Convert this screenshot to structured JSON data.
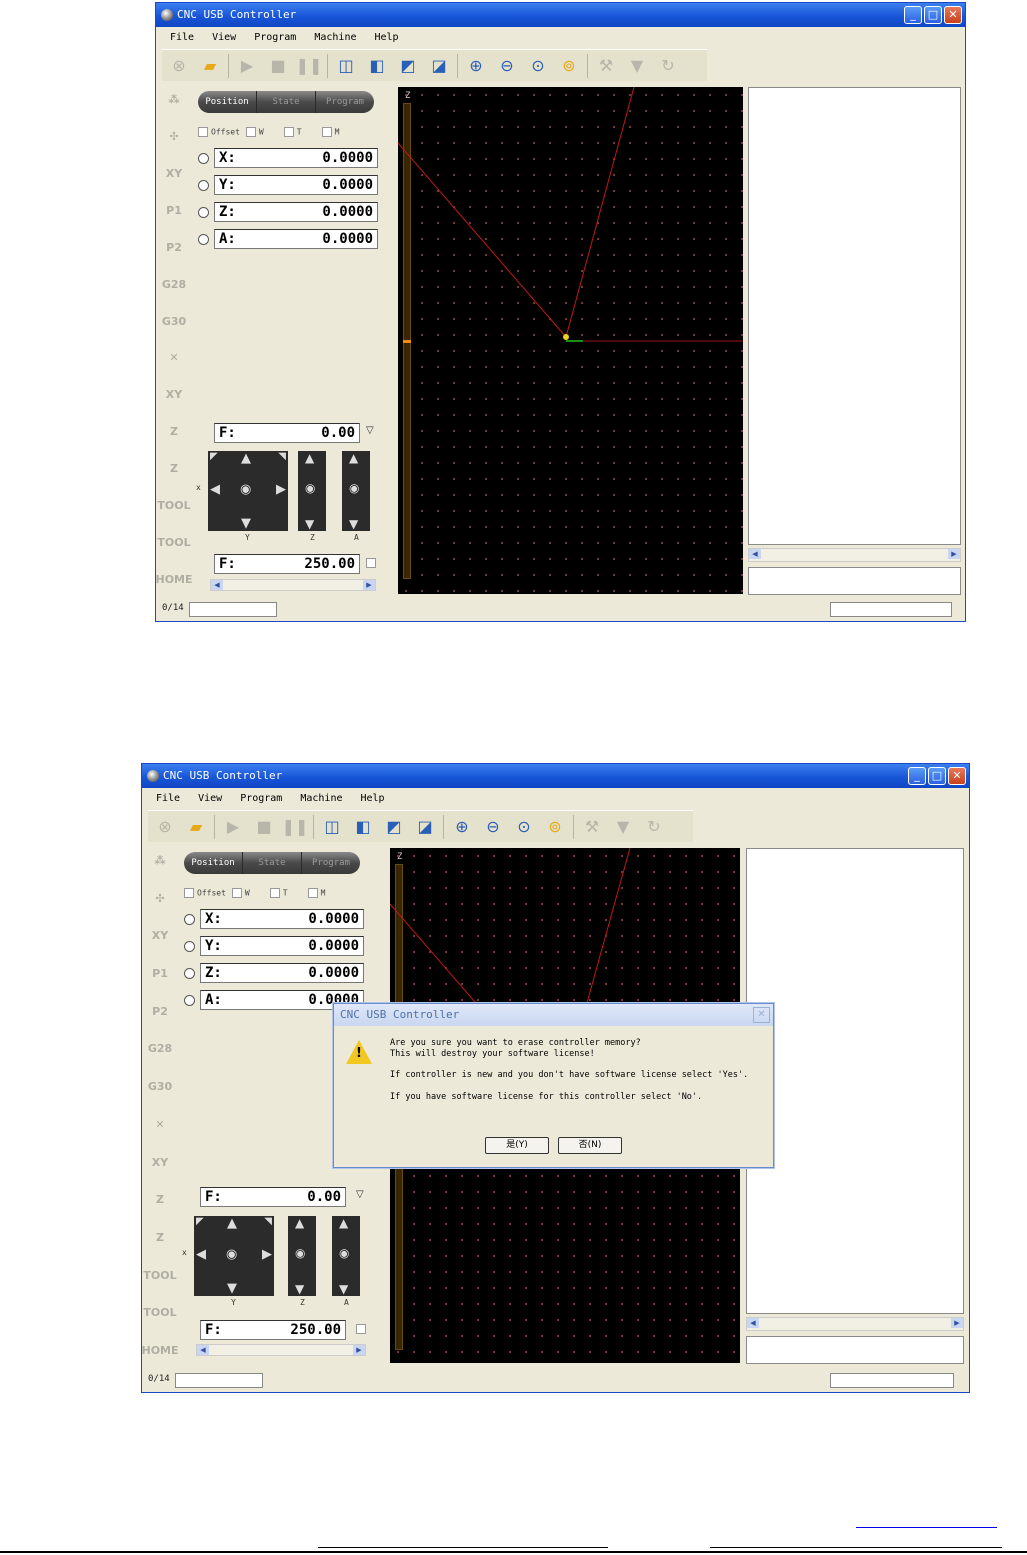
{
  "app": {
    "title": "CNC USB Controller",
    "menu": [
      "File",
      "View",
      "Program",
      "Machine",
      "Help"
    ],
    "title_buttons": [
      "_",
      "□",
      "✕"
    ]
  },
  "toolbar_icons": [
    "stop-icon",
    "open-folder-icon",
    "play-icon",
    "stop-square-icon",
    "pause-icon",
    "cube-front-icon",
    "cube-side-icon",
    "cube-top-icon",
    "cube-iso-icon",
    "zoom-in-icon",
    "zoom-out-icon",
    "zoom-fit-icon",
    "zoom-extents-icon",
    "tool-icon",
    "funnel-icon",
    "refresh-icon"
  ],
  "left_strip": [
    "⁂",
    "✣",
    "XY",
    "P1",
    "P2",
    "G28",
    "G30",
    "✕",
    "XY",
    "Z",
    "Z",
    "TOOL",
    "TOOL",
    "HOME"
  ],
  "tabs": [
    "Position",
    "State",
    "Program"
  ],
  "checkboxes": [
    "Offset",
    "W",
    "T",
    "M"
  ],
  "axes": [
    {
      "label": "X:",
      "value": "0.0000"
    },
    {
      "label": "Y:",
      "value": "0.0000"
    },
    {
      "label": "Z:",
      "value": "0.0000"
    },
    {
      "label": "A:",
      "value": "0.0000"
    }
  ],
  "feed": {
    "label": "F:",
    "value": "0.00"
  },
  "feed_set": {
    "label": "F:",
    "value": "250.00"
  },
  "jog_labels": {
    "x": "x",
    "y": "Y",
    "z": "Z",
    "a": "A"
  },
  "view_axis_label": "Z",
  "status": {
    "counter": "0/14"
  },
  "dialog": {
    "title": "CNC USB Controller",
    "line1": "Are you sure you want to erase controller memory?",
    "line2": "This will destroy your software license!",
    "line3": "If controller is new and you don't have software license select 'Yes'.",
    "line4": "If you have software license for this controller select 'No'.",
    "yes": "是(Y)",
    "no": "否(N)"
  },
  "colors": {
    "titlebar": "#1856d8",
    "toolpath": "#c01818",
    "background_view": "#000000"
  }
}
